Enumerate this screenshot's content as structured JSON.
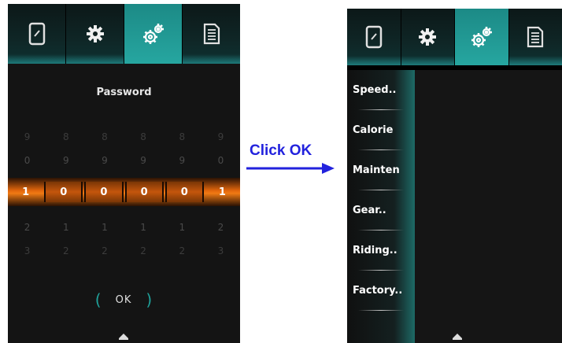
{
  "left_screen": {
    "tabs": [
      {
        "icon": "phone-icon",
        "active": false
      },
      {
        "icon": "gear-icon",
        "active": false
      },
      {
        "icon": "gears-icon",
        "active": true
      },
      {
        "icon": "document-icon",
        "active": false
      }
    ],
    "password_title": "Password",
    "digit_rows": {
      "row_minus2": [
        "9",
        "8",
        "8",
        "8",
        "8",
        "9"
      ],
      "row_minus1": [
        "0",
        "9",
        "9",
        "9",
        "9",
        "0"
      ],
      "selected": [
        "1",
        "0",
        "0",
        "0",
        "0",
        "1"
      ],
      "row_plus1": [
        "2",
        "1",
        "1",
        "1",
        "1",
        "2"
      ],
      "row_plus2": [
        "3",
        "2",
        "2",
        "2",
        "2",
        "3"
      ]
    },
    "ok_label": "OK"
  },
  "annotation": {
    "text": "Click OK",
    "color": "#2222dd"
  },
  "right_screen": {
    "tabs": [
      {
        "icon": "phone-icon",
        "active": false
      },
      {
        "icon": "gear-icon",
        "active": false
      },
      {
        "icon": "gears-icon",
        "active": true
      },
      {
        "icon": "document-icon",
        "active": false
      }
    ],
    "menu_items": [
      "Speed..",
      "Calorie",
      "Mainten",
      "Gear..",
      "Riding..",
      "Factory.."
    ]
  },
  "colors": {
    "accent_teal": "#26a6a0",
    "selection_orange": "#f07a14",
    "background": "#141414"
  }
}
